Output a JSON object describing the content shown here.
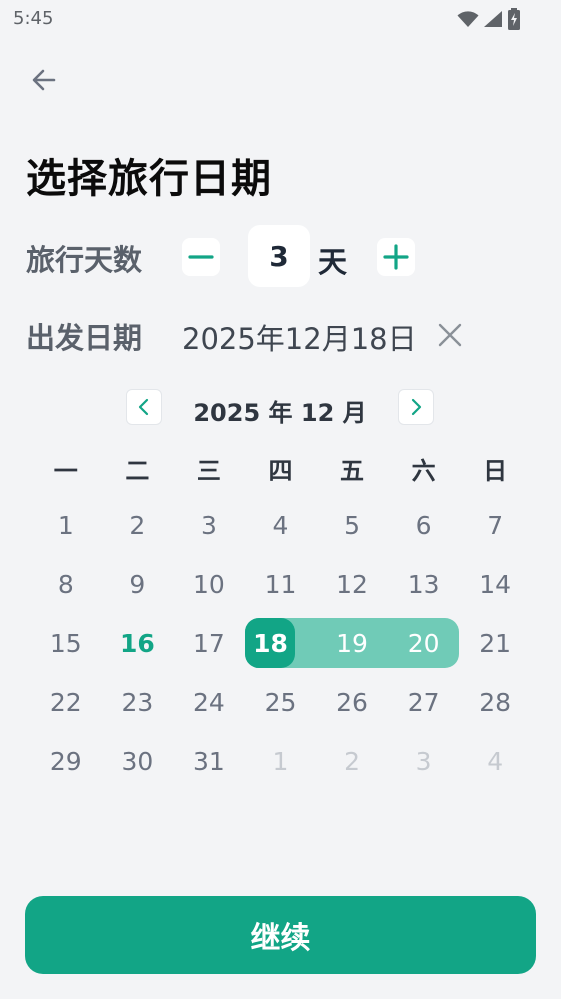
{
  "status_bar": {
    "time": "5:45",
    "icons": [
      "wifi-icon",
      "signal-icon",
      "battery-charging-icon"
    ]
  },
  "header": {
    "back_icon": "arrow-left-icon",
    "title": "选择旅行日期"
  },
  "trip_days": {
    "label": "旅行天数",
    "value": "3",
    "unit": "天"
  },
  "departure": {
    "label": "出发日期",
    "value": "2025年12月18日"
  },
  "calendar": {
    "month_title": "2025 年 12 月",
    "weekdays": [
      "一",
      "二",
      "三",
      "四",
      "五",
      "六",
      "日"
    ],
    "weeks": [
      [
        {
          "d": "1",
          "s": ""
        },
        {
          "d": "2",
          "s": ""
        },
        {
          "d": "3",
          "s": ""
        },
        {
          "d": "4",
          "s": ""
        },
        {
          "d": "5",
          "s": ""
        },
        {
          "d": "6",
          "s": ""
        },
        {
          "d": "7",
          "s": ""
        }
      ],
      [
        {
          "d": "8",
          "s": ""
        },
        {
          "d": "9",
          "s": ""
        },
        {
          "d": "10",
          "s": ""
        },
        {
          "d": "11",
          "s": ""
        },
        {
          "d": "12",
          "s": ""
        },
        {
          "d": "13",
          "s": ""
        },
        {
          "d": "14",
          "s": ""
        }
      ],
      [
        {
          "d": "15",
          "s": ""
        },
        {
          "d": "16",
          "s": "today"
        },
        {
          "d": "17",
          "s": ""
        },
        {
          "d": "18",
          "s": "selected"
        },
        {
          "d": "19",
          "s": "range"
        },
        {
          "d": "20",
          "s": "range range-end"
        },
        {
          "d": "21",
          "s": ""
        }
      ],
      [
        {
          "d": "22",
          "s": ""
        },
        {
          "d": "23",
          "s": ""
        },
        {
          "d": "24",
          "s": ""
        },
        {
          "d": "25",
          "s": ""
        },
        {
          "d": "26",
          "s": ""
        },
        {
          "d": "27",
          "s": ""
        },
        {
          "d": "28",
          "s": ""
        }
      ],
      [
        {
          "d": "29",
          "s": ""
        },
        {
          "d": "30",
          "s": ""
        },
        {
          "d": "31",
          "s": ""
        },
        {
          "d": "1",
          "s": "muted"
        },
        {
          "d": "2",
          "s": "muted"
        },
        {
          "d": "3",
          "s": "muted"
        },
        {
          "d": "4",
          "s": "muted"
        }
      ]
    ]
  },
  "footer": {
    "continue_label": "继续"
  },
  "colors": {
    "accent": "#12a586",
    "range": "#70cbb7",
    "background": "#f3f4f6"
  }
}
